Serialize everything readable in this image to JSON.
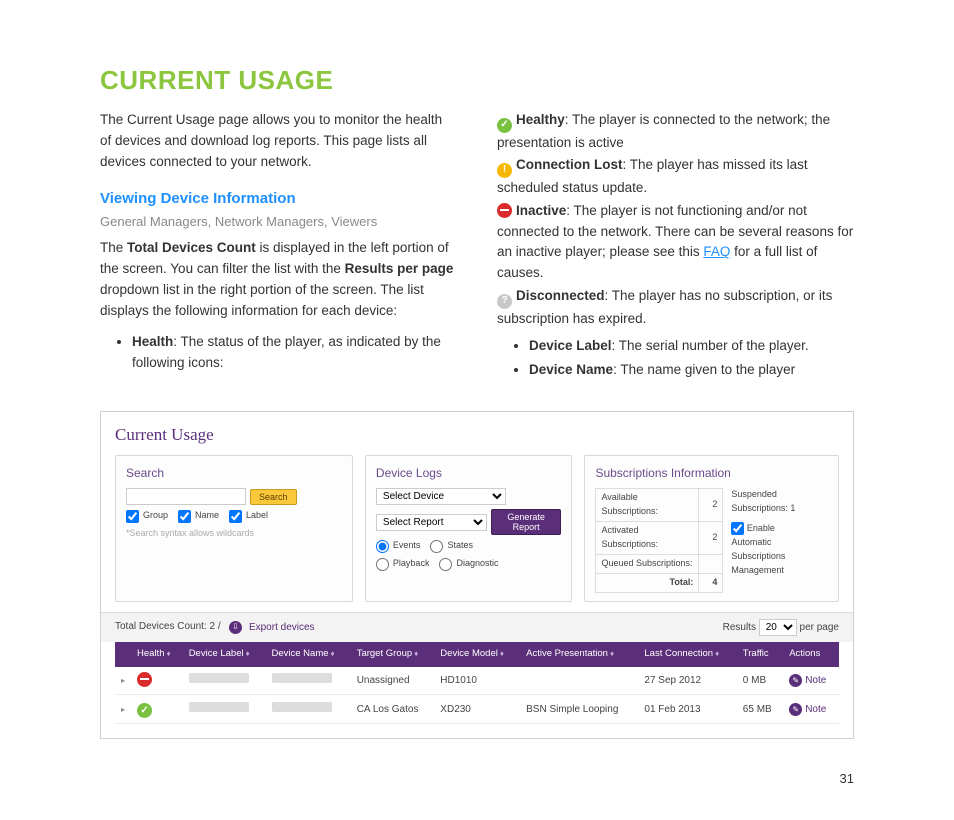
{
  "title": "CURRENT USAGE",
  "intro": "The Current Usage page allows you to monitor the health of devices and download log reports. This page lists all devices connected to your network.",
  "subhead": "Viewing Device Information",
  "roles": "General Managers, Network Managers, Viewers",
  "p1a": "The ",
  "p1b": "Total Devices Count",
  "p1c": " is displayed in the left portion of the screen. You can filter the list with the ",
  "p1d": "Results per page",
  "p1e": " dropdown list in the right portion of the screen. The list displays the following information for each device:",
  "bullet_health_b": "Health",
  "bullet_health_t": ": The status of the player, as indicated by the following icons:",
  "healthy_b": "Healthy",
  "healthy_t": ": The player is connected to the network; the presentation is active",
  "cl_b": "Connection Lost",
  "cl_t": ": The player has missed its last scheduled status update.",
  "in_b": "Inactive",
  "in_t": ": The player is not functioning and/or not connected to the network. There can be several reasons for an inactive player; please see this ",
  "faq": "FAQ",
  "in_t2": " for a full list of causes.",
  "dc_b": "Disconnected",
  "dc_t": ": The player has no subscription, or its subscription has expired.",
  "dl_b": "Device Label",
  "dl_t": ": The serial number of the player.",
  "dn_b": "Device Name",
  "dn_t": ": The name given to the player",
  "page_num": "31",
  "ss": {
    "title": "Current Usage",
    "search": {
      "h": "Search",
      "btn": "Search",
      "chk_group": "Group",
      "chk_name": "Name",
      "chk_label": "Label",
      "hint": "*Search syntax allows wildcards"
    },
    "logs": {
      "h": "Device Logs",
      "sel_device": "Select Device",
      "sel_report": "Select Report",
      "btn": "Generate Report",
      "r1": "Events",
      "r2": "States",
      "r3": "Playback",
      "r4": "Diagnostic"
    },
    "subs": {
      "h": "Subscriptions Information",
      "avail": "Available Subscriptions:",
      "avail_v": "2",
      "act": "Activated Subscriptions:",
      "act_v": "2",
      "que": "Queued Subscriptions:",
      "que_v": "",
      "tot": "Total:",
      "tot_v": "4",
      "susp": "Suspended Subscriptions: 1",
      "auto": "Enable Automatic Subscriptions Management"
    },
    "toolbar": {
      "count_l": "Total Devices Count:  2  /",
      "export": "Export devices",
      "results_l": "Results",
      "results_v": "20",
      "perpage": "per page"
    },
    "cols": {
      "c0": "",
      "c1": "Health",
      "c2": "Device Label",
      "c3": "Device Name",
      "c4": "Target Group",
      "c5": "Device Model",
      "c6": "Active Presentation",
      "c7": "Last Connection",
      "c8": "Traffic",
      "c9": "Actions"
    },
    "rows": [
      {
        "health": "inactive",
        "group": "Unassigned",
        "model": "HD1010",
        "pres": "",
        "last": "27 Sep 2012",
        "traffic": "0 MB",
        "action": "Note"
      },
      {
        "health": "healthy",
        "group": "CA Los Gatos",
        "model": "XD230",
        "pres": "BSN Simple Looping",
        "last": "01 Feb 2013",
        "traffic": "65 MB",
        "action": "Note"
      }
    ]
  }
}
